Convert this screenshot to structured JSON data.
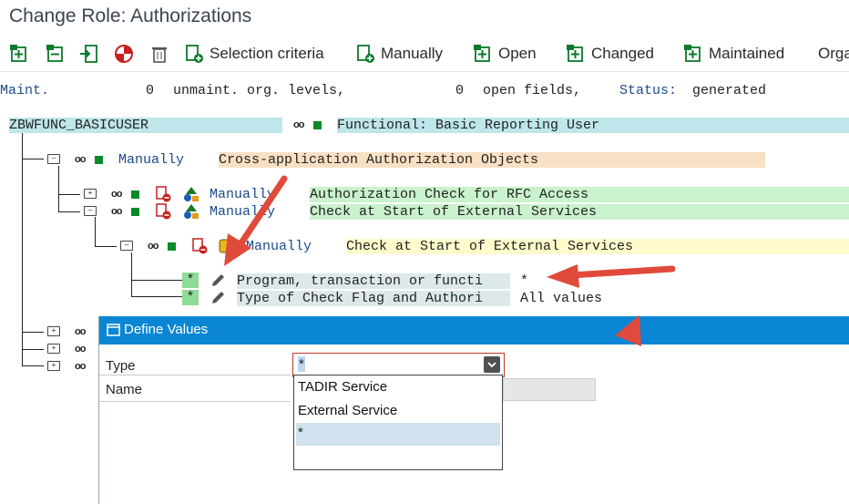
{
  "window": {
    "title": "Change Role: Authorizations"
  },
  "toolbar": {
    "selection_criteria": "Selection criteria",
    "manually": "Manually",
    "open": "Open",
    "changed": "Changed",
    "maintained": "Maintained",
    "org_truncated": "Orga"
  },
  "status_line": {
    "maint_label": "Maint.",
    "unmaint_count": "0",
    "unmaint_text": "unmaint. org. levels,",
    "open_count": "0",
    "open_text": "open fields,",
    "status_label": "Status:",
    "status_value": "generated"
  },
  "tree": {
    "role_name": "ZBWFUNC_BASICUSER",
    "role_desc": "Functional: Basic Reporting User",
    "class_node": {
      "status": "Manually",
      "text": "Cross-application Authorization Objects"
    },
    "obj1": {
      "status": "Manually",
      "text": "Authorization Check for RFC Access"
    },
    "obj2": {
      "status": "Manually",
      "text": "Check at Start of External Services"
    },
    "auth": {
      "status": "Manually",
      "text": "Check at Start of External Services"
    },
    "field1": {
      "value_cell": "*",
      "label": "Program, transaction or functi",
      "value": "*"
    },
    "field2": {
      "value_cell": "*",
      "label": "Type of Check Flag and Authori",
      "value": "All values"
    }
  },
  "dialog": {
    "title": "Define Values",
    "type_label": "Type",
    "type_value": "*",
    "name_label": "Name",
    "options": [
      "TADIR Service",
      "External Service",
      "*"
    ]
  },
  "colors": {
    "dialog_header": "#0a86d4",
    "arrow": "#e04a3c",
    "status_green": "#0a8a2a"
  }
}
